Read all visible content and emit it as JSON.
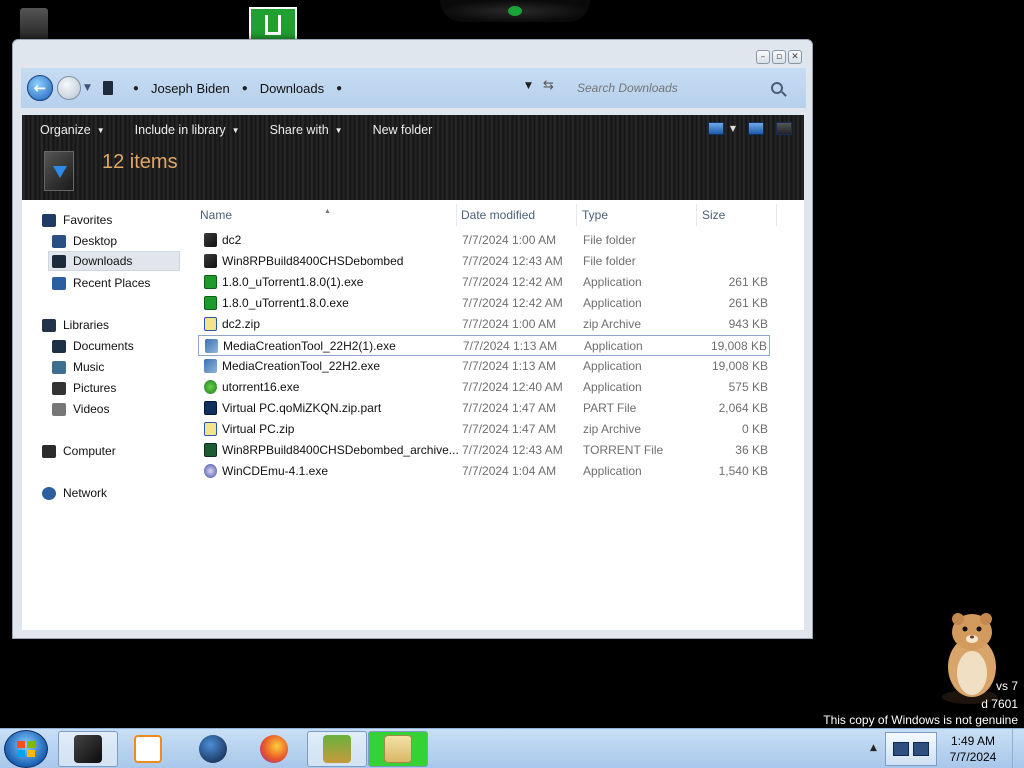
{
  "window": {
    "breadcrumb": [
      "Joseph Biden",
      "Downloads"
    ],
    "search_placeholder": "Search Downloads",
    "toolbar": {
      "organize": "Organize",
      "include_in_library": "Include in library",
      "share_with": "Share with",
      "new_folder": "New folder"
    },
    "item_count": "12 items"
  },
  "nav_pane": {
    "favorites": "Favorites",
    "desktop": "Desktop",
    "downloads": "Downloads",
    "recent_places": "Recent Places",
    "libraries": "Libraries",
    "documents": "Documents",
    "music": "Music",
    "pictures": "Pictures",
    "videos": "Videos",
    "computer": "Computer",
    "network": "Network"
  },
  "columns": {
    "name": "Name",
    "date_modified": "Date modified",
    "type": "Type",
    "size": "Size"
  },
  "files": [
    {
      "name": "dc2",
      "date": "7/7/2024 1:00 AM",
      "type": "File folder",
      "size": "",
      "icon": "folder-icon"
    },
    {
      "name": "Win8RPBuild8400CHSDebombed",
      "date": "7/7/2024 12:43 AM",
      "type": "File folder",
      "size": "",
      "icon": "folder-icon"
    },
    {
      "name": "1.8.0_uTorrent1.8.0(1).exe",
      "date": "7/7/2024 12:42 AM",
      "type": "Application",
      "size": "261 KB",
      "icon": "utorrent-icon"
    },
    {
      "name": "1.8.0_uTorrent1.8.0.exe",
      "date": "7/7/2024 12:42 AM",
      "type": "Application",
      "size": "261 KB",
      "icon": "utorrent-icon"
    },
    {
      "name": "dc2.zip",
      "date": "7/7/2024 1:00 AM",
      "type": "zip Archive",
      "size": "943 KB",
      "icon": "zip-icon"
    },
    {
      "name": "MediaCreationTool_22H2(1).exe",
      "date": "7/7/2024 1:13 AM",
      "type": "Application",
      "size": "19,008 KB",
      "icon": "media-creation-tool-icon"
    },
    {
      "name": "MediaCreationTool_22H2.exe",
      "date": "7/7/2024 1:13 AM",
      "type": "Application",
      "size": "19,008 KB",
      "icon": "media-creation-tool-icon"
    },
    {
      "name": "utorrent16.exe",
      "date": "7/7/2024 12:40 AM",
      "type": "Application",
      "size": "575 KB",
      "icon": "utorrent-green-icon"
    },
    {
      "name": "Virtual PC.qoMiZKQN.zip.part",
      "date": "7/7/2024 1:47 AM",
      "type": "PART File",
      "size": "2,064 KB",
      "icon": "part-file-icon"
    },
    {
      "name": "Virtual PC.zip",
      "date": "7/7/2024 1:47 AM",
      "type": "zip Archive",
      "size": "0 KB",
      "icon": "zip-icon"
    },
    {
      "name": "Win8RPBuild8400CHSDebombed_archive...",
      "date": "7/7/2024 12:43 AM",
      "type": "TORRENT File",
      "size": "36 KB",
      "icon": "torrent-file-icon"
    },
    {
      "name": "WinCDEmu-4.1.exe",
      "date": "7/7/2024 1:04 AM",
      "type": "Application",
      "size": "1,540 KB",
      "icon": "wincdemu-icon"
    }
  ],
  "watermark": {
    "line1": "vs 7",
    "line2": "d 7601",
    "line3": "This copy of Windows is not genuine"
  },
  "taskbar": {
    "time": "1:49 AM",
    "date": "7/7/2024",
    "pinned": [
      "explorer-icon",
      "media-player-icon",
      "globe-icon",
      "firefox-icon",
      "box-game-icon",
      "folder-green-icon"
    ]
  },
  "colors": {
    "item_count": "#e0a766",
    "toolbar_bg": "#1b1b1b",
    "address_bar_bg": "#c6dcf3",
    "taskbar_bg": "#b8d3ef"
  }
}
